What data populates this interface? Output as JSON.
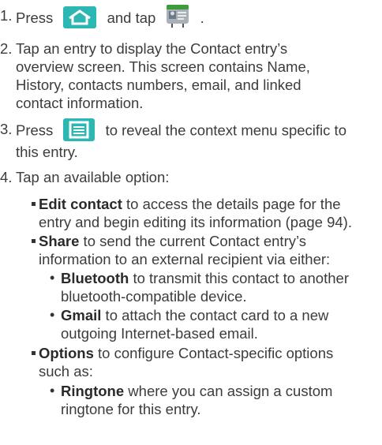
{
  "steps": [
    {
      "num": "1.",
      "pre": "Press",
      "mid": "and tap",
      "post": "."
    },
    {
      "num": "2.",
      "lines": [
        "Tap an entry to display the Contact entry’s",
        "overview screen. This screen contains Name,",
        "History, contacts numbers, email, and linked",
        "contact information."
      ]
    },
    {
      "num": "3.",
      "pre": "Press",
      "post": "to reveal the context menu specific to",
      "line2": "this entry."
    },
    {
      "num": "4.",
      "text": "Tap an available option:"
    }
  ],
  "options": {
    "edit": {
      "term": "Edit contact",
      "rest": " to access the details page for the",
      "line2": "entry and begin editing its information (page 94)."
    },
    "share": {
      "term": "Share",
      "rest": " to send the current Contact entry’s",
      "line2": "information to an external recipient via either:"
    },
    "bluetooth": {
      "term": "Bluetooth",
      "rest": " to transmit this contact to another",
      "line2": "bluetooth-compatible device."
    },
    "gmail": {
      "term": "Gmail",
      "rest": " to attach the contact card to a new",
      "line2": "outgoing Internet-based email."
    },
    "options": {
      "term": "Options",
      "rest": " to configure Contact-specific options",
      "line2": "such as:"
    },
    "ringtone": {
      "term": "Ringtone",
      "rest": " where you can assign a custom",
      "line2": "ringtone for this entry."
    }
  },
  "icons": {
    "home_key": "home-icon",
    "contacts_app": "contacts-app-icon",
    "menu_key": "menu-icon"
  },
  "colors": {
    "key_teal": "#2db7b3",
    "text": "#3c3c3c"
  }
}
